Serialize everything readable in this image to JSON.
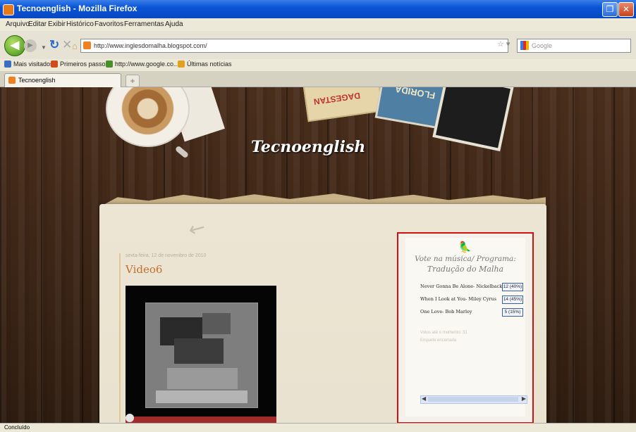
{
  "window": {
    "title": "Tecnoenglish - Mozilla Firefox"
  },
  "menu": [
    "Arquivo",
    "Editar",
    "Exibir",
    "Histórico",
    "Favoritos",
    "Ferramentas",
    "Ajuda"
  ],
  "nav": {
    "url": "http://www.inglesdomalha.blogspot.com/",
    "search_placeholder": "Google"
  },
  "bookmarks": [
    {
      "label": "Mais visitados",
      "color": "#3a6fc2"
    },
    {
      "label": "Primeiros passos",
      "color": "#d04a1a"
    },
    {
      "label": "http://www.google.co...",
      "color": "#4a8f2a"
    },
    {
      "label": "Últimas notícias",
      "color": "#e0a020"
    }
  ],
  "tab": {
    "label": "Tecnoenglish"
  },
  "blog": {
    "title": "Tecnoenglish",
    "header_card1": "DAGESTAN",
    "header_card2": "FLORIDA"
  },
  "post": {
    "date": "sexta-feira, 12 de novembro de 2010",
    "title": "Video6",
    "video_progress": 0.0
  },
  "poll": {
    "title": "Vote na música/ Programa:",
    "subtitle": "Tradução do Malha",
    "options": [
      {
        "song": "Never Gonna Be Alone- Nickelback",
        "result": "12 (40%)"
      },
      {
        "song": "When I Look at You- Miley Cyrus",
        "result": "14 (45%)"
      },
      {
        "song": "One Love- Bob Marley",
        "result": "5 (15%)"
      }
    ],
    "votes_text": "Votos até o momento: 31",
    "status_text": "Enquete encerrada"
  },
  "status": {
    "text": "Concluído"
  },
  "colors": {
    "highlight_border": "#d40f0f",
    "post_title": "#c0702a"
  }
}
